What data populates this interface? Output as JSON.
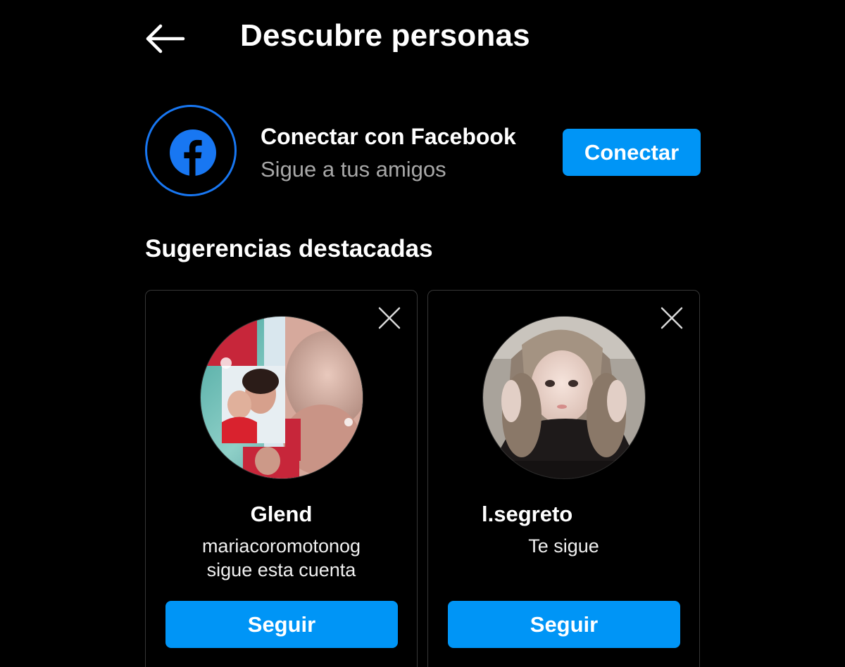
{
  "header": {
    "title": "Descubre personas",
    "back_icon": "arrow-left-icon"
  },
  "facebook_connect": {
    "title": "Conectar con Facebook",
    "subtitle": "Sigue a tus amigos",
    "button_label": "Conectar",
    "icon": "facebook-icon",
    "brand_color": "#1877F2"
  },
  "suggestions": {
    "section_title": "Sugerencias destacadas",
    "cards": [
      {
        "name": "Glend",
        "meta_line_1": "mariacoromotonog",
        "meta_line_2": "sigue esta cuenta",
        "button_label": "Seguir",
        "dismiss_icon": "close-icon",
        "avatar": "profile-photo"
      },
      {
        "name": "l.segreto",
        "meta_line_1": "Te sigue",
        "meta_line_2": "",
        "button_label": "Seguir",
        "dismiss_icon": "close-icon",
        "avatar": "profile-photo"
      }
    ]
  },
  "colors": {
    "background": "#000000",
    "primary_button": "#0095F6",
    "secondary_text": "#a8a8a8",
    "card_border": "#363636"
  }
}
